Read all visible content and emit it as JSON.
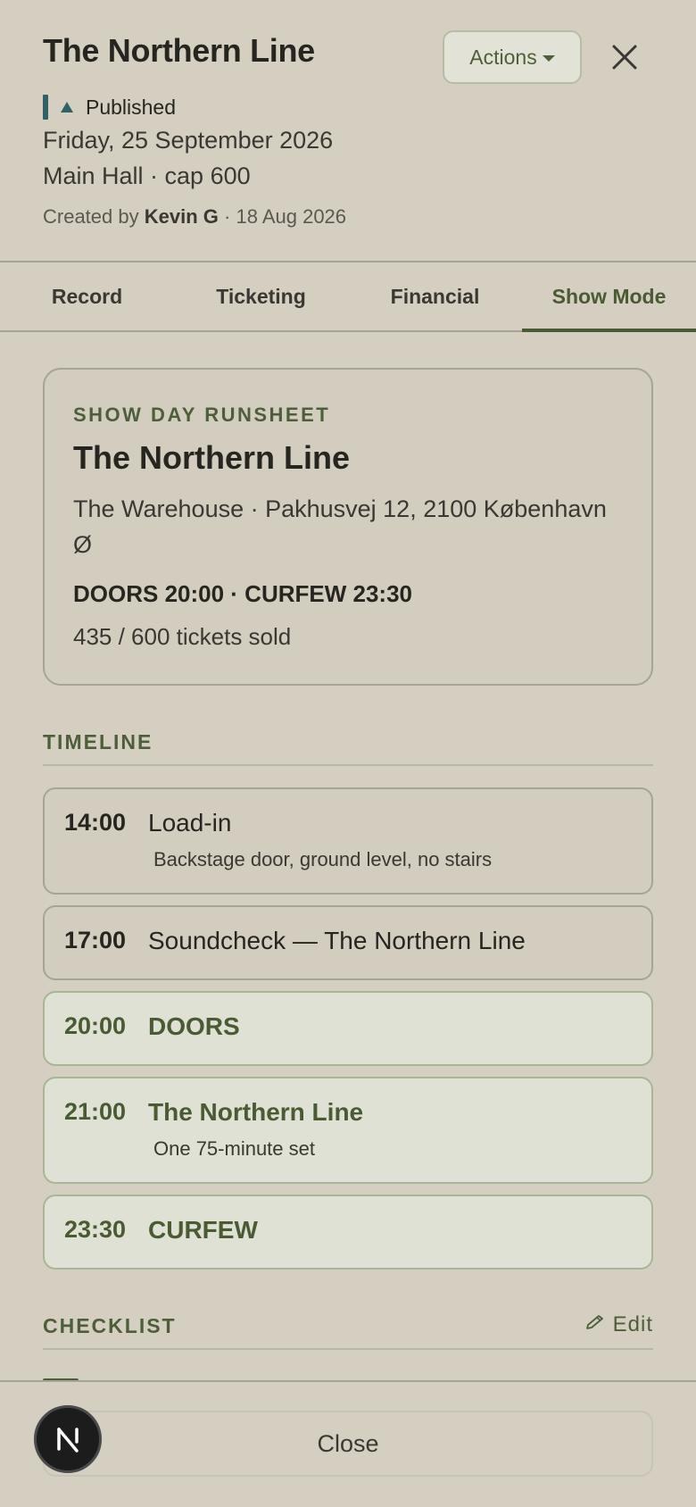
{
  "header": {
    "title": "The Northern Line",
    "actions_label": "Actions",
    "status": "Published",
    "date": "Friday, 25 September 2026",
    "venue": "Main Hall · cap 600",
    "created_prefix": "Created by",
    "created_by": "Kevin G",
    "created_suffix": "· 18 Aug 2026"
  },
  "tabs": [
    {
      "label": "Record"
    },
    {
      "label": "Ticketing"
    },
    {
      "label": "Financial"
    },
    {
      "label": "Show Mode",
      "active": true
    }
  ],
  "runsheet": {
    "kicker": "SHOW DAY RUNSHEET",
    "title": "The Northern Line",
    "address": "The Warehouse · Pakhusvej 12, 2100 København Ø",
    "times": "DOORS 20:00 · CURFEW 23:30",
    "tickets": "435 / 600 tickets sold"
  },
  "timeline": {
    "label": "TIMELINE",
    "items": [
      {
        "time": "14:00",
        "label": "Load-in",
        "sub": "Backstage door, ground level, no stairs",
        "highlight": false
      },
      {
        "time": "17:00",
        "label": "Soundcheck — The Northern Line",
        "sub": "",
        "highlight": false
      },
      {
        "time": "20:00",
        "label": "DOORS",
        "sub": "",
        "highlight": true
      },
      {
        "time": "21:00",
        "label": "The Northern Line",
        "sub": "One 75-minute set",
        "highlight": true
      },
      {
        "time": "23:30",
        "label": "CURFEW",
        "sub": "",
        "highlight": true
      }
    ]
  },
  "checklist": {
    "label": "CHECKLIST",
    "edit_label": "Edit"
  },
  "footer": {
    "close_label": "Close",
    "badge_letter": "N"
  },
  "colors": {
    "background": "#d5cfc2",
    "accent": "#4a5a34",
    "status": "#2e6266"
  }
}
